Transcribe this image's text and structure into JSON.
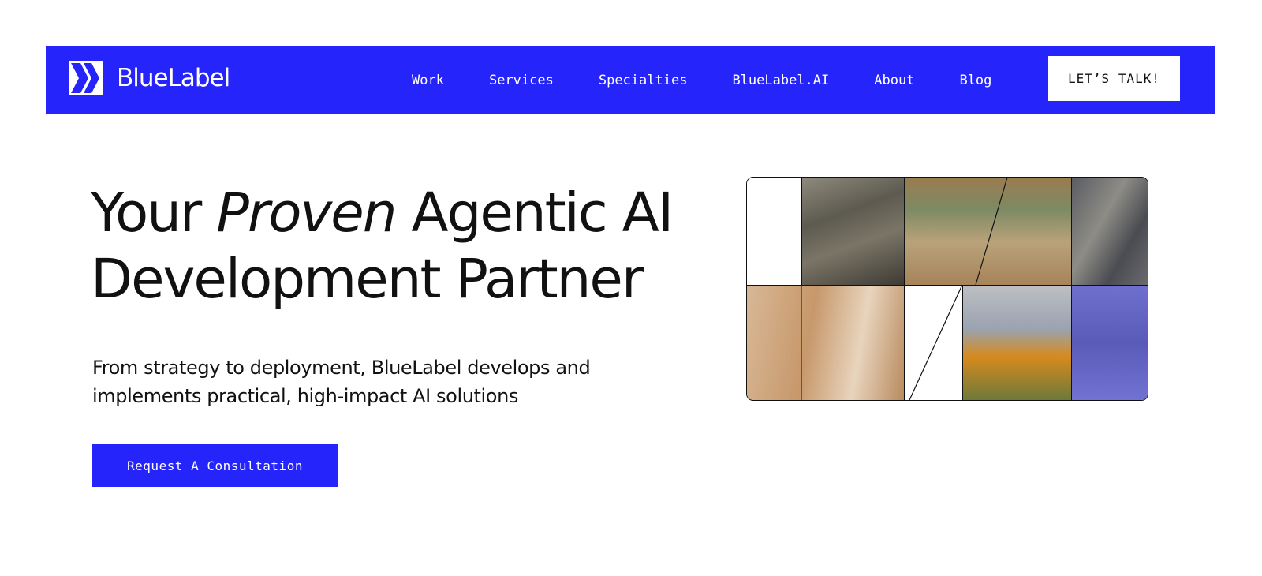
{
  "brand": {
    "name": "BlueLabel",
    "accent": "#2525fb"
  },
  "nav": {
    "items": [
      "Work",
      "Services",
      "Specialties",
      "BlueLabel.AI",
      "About",
      "Blog"
    ],
    "cta_label": "LET’S TALK!"
  },
  "hero": {
    "title_part1": "Your ",
    "title_italic": "Proven",
    "title_part2": " Agentic AI",
    "title_line2": "Development Partner",
    "subtitle": "From strategy to deployment, BlueLabel develops and implements practical, high-impact AI solutions",
    "cta_label": "Request A Consultation"
  }
}
